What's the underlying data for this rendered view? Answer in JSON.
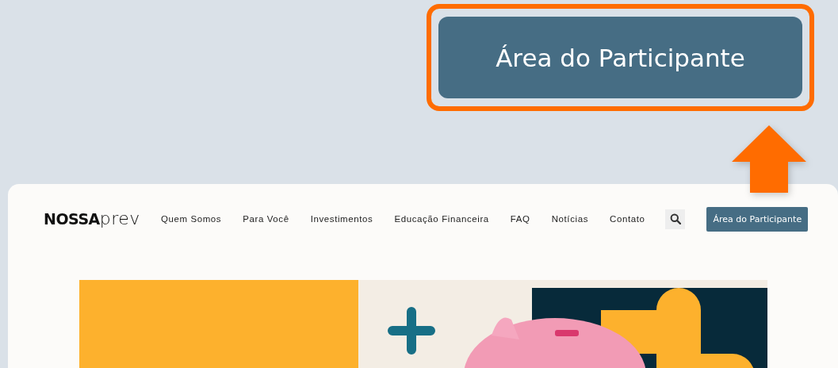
{
  "callout": {
    "button_label": "Área do Participante"
  },
  "header": {
    "logo": {
      "bold": "NOSSA",
      "light": "prev"
    },
    "nav": [
      "Quem Somos",
      "Para Você",
      "Investimentos",
      "Educação Financeira",
      "FAQ",
      "Notícias",
      "Contato"
    ],
    "cta_label": "Área do Participante"
  }
}
